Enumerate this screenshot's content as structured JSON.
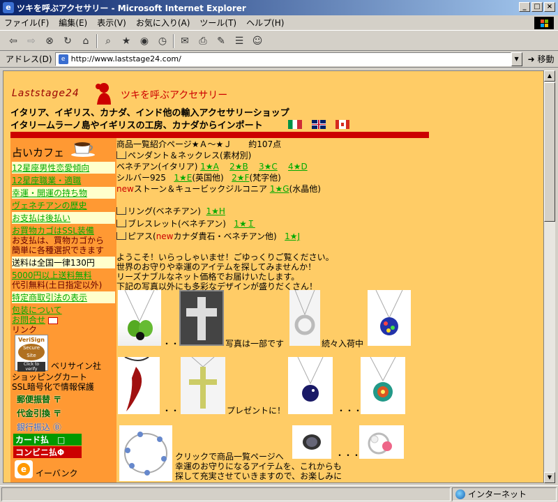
{
  "window": {
    "title": "ツキを呼ぶアクセサリー - Microsoft Internet Explorer",
    "buttons": [
      "_",
      "□",
      "×"
    ]
  },
  "menu": [
    "ファイル(F)",
    "編集(E)",
    "表示(V)",
    "お気に入り(A)",
    "ツール(T)",
    "ヘルプ(H)"
  ],
  "address": {
    "label": "アドレス(D)",
    "url": "http://www.laststage24.com/",
    "go": "移動"
  },
  "status": {
    "zone": "インターネット"
  },
  "page": {
    "logo_text": "Laststage24",
    "logo_title": "ツキを呼ぶアクセサリー",
    "heading_line1": "イタリア、イギリス、カナダ、インド他の輸入アクセサリーショップ",
    "heading_line2": "イタリームラーノ島やイギリスの工房、カナダからインポート",
    "sidebar": {
      "title": "占いカフェ",
      "items": [
        {
          "text": "12星座男性恋愛傾向",
          "type": "link"
        },
        {
          "text": "12星座職業・適職",
          "type": "link"
        },
        {
          "text": "幸運・開運の持ち物",
          "type": "link"
        },
        {
          "text": "ヴェネチアンの歴史",
          "type": "link"
        },
        {
          "text": "お支払は後払い",
          "type": "link"
        },
        {
          "text": "お買物カゴはSSL装備",
          "type": "link"
        },
        {
          "text": "お支払は、買物カゴから",
          "type": "text"
        },
        {
          "text": "簡単に各種選択できます",
          "type": "text"
        },
        {
          "text": "送料は全国一律130円",
          "type": "text"
        },
        {
          "text": "5000円以上送料無料",
          "type": "link"
        },
        {
          "text": "代引無料(土日指定以外)",
          "type": "text"
        },
        {
          "text": "特定商取引法の表示",
          "type": "link"
        },
        {
          "text": "包装について",
          "type": "link"
        },
        {
          "text": "お問合せ",
          "type": "link"
        },
        {
          "text": "リンク",
          "type": "text"
        }
      ],
      "verisign_label": "ベリサイン社",
      "ssl_line1": "ショッピングカート",
      "ssl_line2": "SSL暗号化で情報保護",
      "pay_postal": "郵便振替",
      "pay_cod": "代金引換",
      "pay_bank": "銀行振込",
      "pay_card": "カード払",
      "pay_conv": "コンビニ払",
      "ebank": "イーバンク",
      "verisign_badge": "Secure Site",
      "verisign_badge_top": "VeriSign",
      "verisign_badge_bottom": "Click to verify"
    },
    "main": {
      "intro": "商品一覧紹介ページ★Ａ～★Ｊ　　約107点",
      "pendant": "ペンダント＆ネックレス(素材別)",
      "venetian": "ベネチアン(イタリア)",
      "venetian_links": [
        "1★A",
        "2★B",
        "3★C",
        "4★D"
      ],
      "silver": "シルバー925",
      "silver_e": "1★E",
      "silver_e_note": "(英国他)",
      "silver_f": "2★F",
      "silver_f_note": "(梵字他)",
      "new_label": "new",
      "stone": "ストーン＆キュービックジルコニア",
      "stone_link": "1★G",
      "stone_note": "(水晶他)",
      "ring": "リング(ベネチアン)",
      "ring_link": "1★H",
      "bracelet": "ブレスレット(ベネチアン)",
      "bracelet_link": "1★Ｉ",
      "pierce_a": "ピアス(",
      "pierce_new": "new",
      "pierce_b": "カナダ貴石・ベネチアン他)",
      "pierce_link": "1★J",
      "welcome": [
        "ようこそ！いらっしゃいませ！ごゆっくりご覧ください。",
        "世界のお守りや幸運のアイテムを探してみませんか！",
        "リーズナブルなネット価格でお届けいたします。",
        "下記の写真以外にも多彩なデザインが盛りだくさん！"
      ],
      "row1_text_a": "写真は一部です",
      "row1_text_b": "続々入荷中",
      "row2_text": "プレゼントに！",
      "row3_text1": "クリックで商品一覧ページへ",
      "row3_text2": "幸運のお守りになるアイテムを、これからも",
      "row3_text3": "探して充実させていきますので、お楽しみに",
      "dots": "・・",
      "dots3": "・・・"
    }
  },
  "colors": {
    "page_bg": "#ffcc66",
    "sidebar_bg": "#ff9933",
    "link": "#00aa00",
    "red": "#cc0000"
  }
}
